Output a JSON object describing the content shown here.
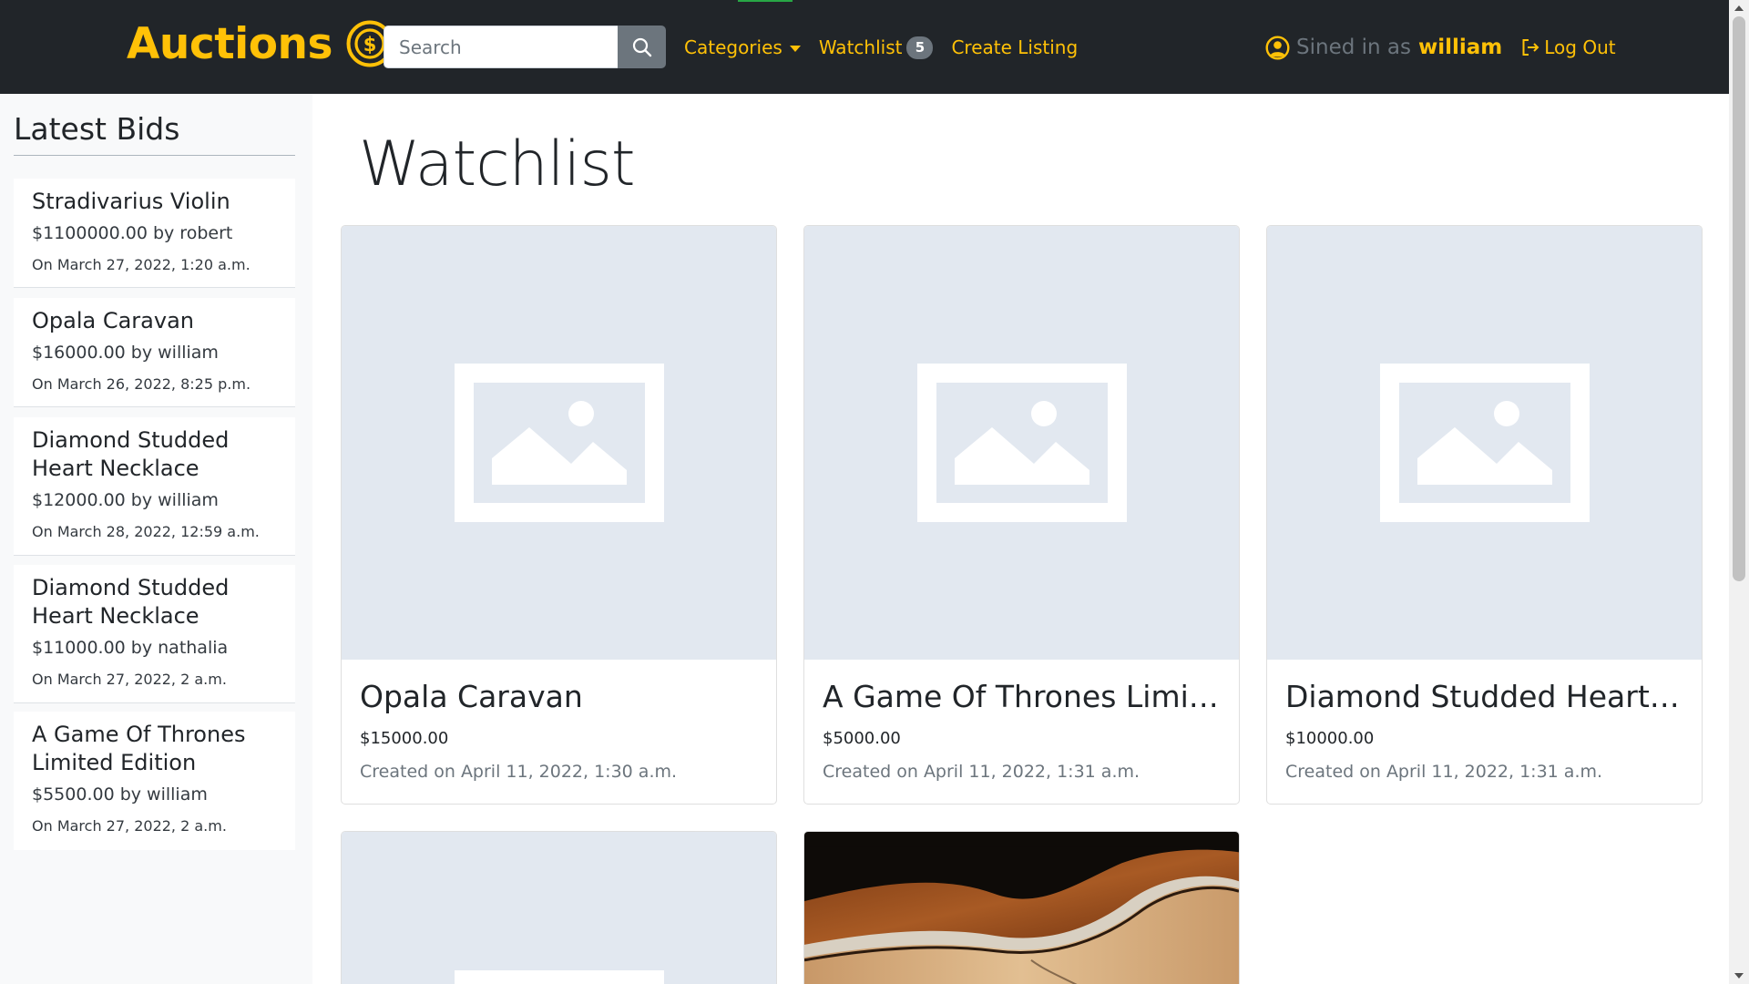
{
  "colors": {
    "brand": "#ffc107",
    "navbar": "#212529",
    "muted": "#6c757d",
    "placeholder_bg": "#e2e8f0"
  },
  "navbar": {
    "brand_label": "Auctions",
    "brand_icon": "dollar-coin-icon",
    "search": {
      "placeholder": "Search",
      "value": "",
      "icon": "search-icon"
    },
    "categories_label": "Categories",
    "watchlist_label": "Watchlist",
    "watchlist_count": "5",
    "create_listing_label": "Create Listing",
    "signed_in_text": "Sined in as",
    "username": "william",
    "user_icon": "user-circle-icon",
    "logout_label": "Log Out",
    "logout_icon": "logout-icon"
  },
  "sidebar": {
    "title": "Latest Bids",
    "bids": [
      {
        "title": "Stradivarius Violin",
        "amount": "$1100000.00 by robert",
        "date": "On March 27, 2022, 1:20 a.m."
      },
      {
        "title": "Opala Caravan",
        "amount": "$16000.00 by william",
        "date": "On March 26, 2022, 8:25 p.m."
      },
      {
        "title": "Diamond Studded Heart Necklace",
        "amount": "$12000.00 by william",
        "date": "On March 28, 2022, 12:59 a.m."
      },
      {
        "title": "Diamond Studded Heart Necklace",
        "amount": "$11000.00 by nathalia",
        "date": "On March 27, 2022, 2 a.m."
      },
      {
        "title": "A Game Of Thrones Limited Edition",
        "amount": "$5500.00 by william",
        "date": "On March 27, 2022, 2 a.m."
      }
    ]
  },
  "main": {
    "title": "Watchlist",
    "listings": [
      {
        "title": "Opala Caravan",
        "price": "$15000.00",
        "date": "Created on April 11, 2022, 1:30 a.m.",
        "image": "placeholder-image-icon"
      },
      {
        "title": "A Game Of Thrones Limited Edition",
        "price": "$5000.00",
        "date": "Created on April 11, 2022, 1:31 a.m.",
        "image": "placeholder-image-icon"
      },
      {
        "title": "Diamond Studded Heart Necklace",
        "price": "$10000.00",
        "date": "Created on April 11, 2022, 1:31 a.m.",
        "image": "placeholder-image-icon"
      },
      {
        "title": "",
        "price": "",
        "date": "",
        "image": "placeholder-image-icon"
      },
      {
        "title": "",
        "price": "",
        "date": "",
        "image": "guitar-photo"
      }
    ]
  }
}
